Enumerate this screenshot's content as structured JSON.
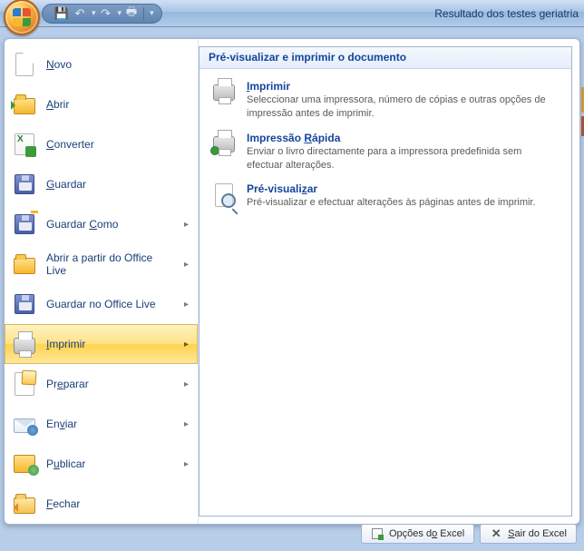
{
  "window": {
    "title": "Resultado dos testes geriatria"
  },
  "qat": {
    "save": "save-icon",
    "undo": "undo-icon",
    "redo": "redo-icon",
    "print": "quick-print-icon"
  },
  "office_menu": {
    "items": [
      {
        "key": "novo",
        "label": "Novo",
        "submenu": false
      },
      {
        "key": "abrir",
        "label": "Abrir",
        "submenu": false
      },
      {
        "key": "converter",
        "label": "Converter",
        "submenu": false
      },
      {
        "key": "guardar",
        "label": "Guardar",
        "submenu": false
      },
      {
        "key": "guardar_como",
        "label": "Guardar Como",
        "submenu": true
      },
      {
        "key": "abrir_live",
        "label": "Abrir a partir do Office Live",
        "submenu": true
      },
      {
        "key": "guardar_live",
        "label": "Guardar no Office Live",
        "submenu": true
      },
      {
        "key": "imprimir",
        "label": "Imprimir",
        "submenu": true,
        "active": true
      },
      {
        "key": "preparar",
        "label": "Preparar",
        "submenu": true
      },
      {
        "key": "enviar",
        "label": "Enviar",
        "submenu": true
      },
      {
        "key": "publicar",
        "label": "Publicar",
        "submenu": true
      },
      {
        "key": "fechar",
        "label": "Fechar",
        "submenu": false
      }
    ]
  },
  "right_panel": {
    "header": "Pré-visualizar e imprimir o documento",
    "items": [
      {
        "key": "print",
        "title": "Imprimir",
        "desc": "Seleccionar uma impressora, número de cópias e outras opções de impressão antes de imprimir."
      },
      {
        "key": "quick_print",
        "title": "Impressão Rápida",
        "desc": "Enviar o livro directamente para a impressora predefinida sem efectuar alterações."
      },
      {
        "key": "preview",
        "title": "Pré-visualizar",
        "desc": "Pré-visualizar e efectuar alterações às páginas antes de imprimir."
      }
    ]
  },
  "bottom": {
    "options": "Opções do Excel",
    "exit": "Sair do Excel"
  }
}
